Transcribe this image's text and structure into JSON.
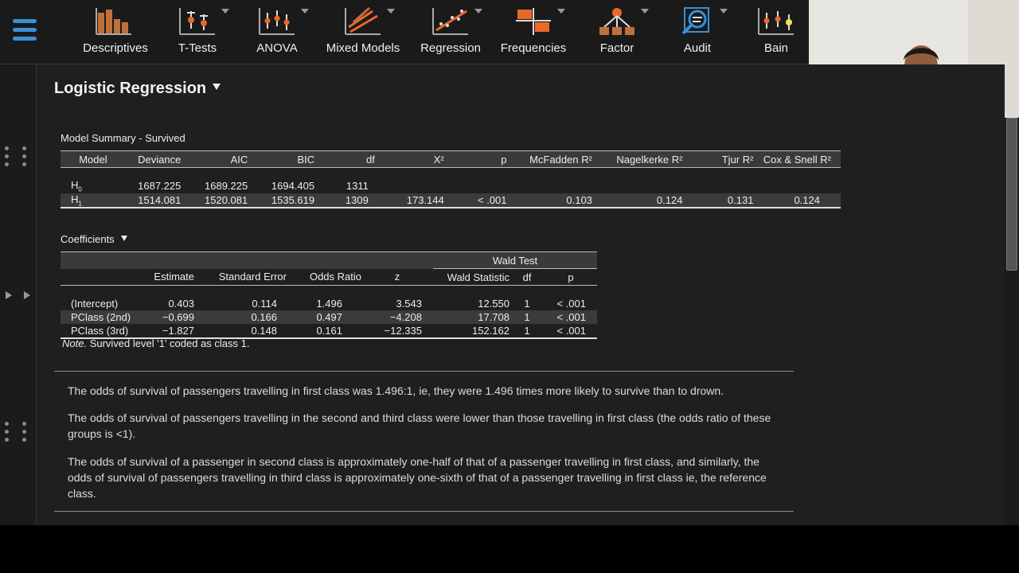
{
  "toolbar": {
    "modules": [
      {
        "label": "Descriptives",
        "icon": "descriptives-icon"
      },
      {
        "label": "T-Tests",
        "icon": "t-tests-icon"
      },
      {
        "label": "ANOVA",
        "icon": "anova-icon"
      },
      {
        "label": "Mixed Models",
        "icon": "mixed-models-icon"
      },
      {
        "label": "Regression",
        "icon": "regression-icon"
      },
      {
        "label": "Frequencies",
        "icon": "frequencies-icon"
      },
      {
        "label": "Factor",
        "icon": "factor-icon"
      },
      {
        "label": "Audit",
        "icon": "audit-icon"
      },
      {
        "label": "Bain",
        "icon": "bain-icon"
      }
    ],
    "colors": {
      "accent": "#3a8fd8",
      "orange": "#e8692a",
      "bar": "#c0703a"
    }
  },
  "analysis": {
    "title": "Logistic Regression"
  },
  "model_summary": {
    "title": "Model Summary - Survived",
    "columns": [
      "Model",
      "Deviance",
      "AIC",
      "BIC",
      "df",
      "X²",
      "p",
      "McFadden R²",
      "Nagelkerke R²",
      "Tjur R²",
      "Cox & Snell R²"
    ],
    "rows": [
      {
        "model": "H",
        "sub": "0",
        "deviance": "1687.225",
        "aic": "1689.225",
        "bic": "1694.405",
        "df": "1311",
        "x2": "",
        "p": "",
        "mcfadden": "",
        "nagelkerke": "",
        "tjur": "",
        "coxsnell": ""
      },
      {
        "model": "H",
        "sub": "1",
        "deviance": "1514.081",
        "aic": "1520.081",
        "bic": "1535.619",
        "df": "1309",
        "x2": "173.144",
        "p": "< .001",
        "mcfadden": "0.103",
        "nagelkerke": "0.124",
        "tjur": "0.131",
        "coxsnell": "0.124"
      }
    ]
  },
  "coefficients": {
    "title": "Coefficients",
    "group_header": "Wald Test",
    "columns": [
      "",
      "Estimate",
      "Standard Error",
      "Odds Ratio",
      "z",
      "Wald Statistic",
      "df",
      "p"
    ],
    "rows": [
      {
        "term": "(Intercept)",
        "estimate": "0.403",
        "se": "0.114",
        "or": "1.496",
        "z": "3.543",
        "wald": "12.550",
        "df": "1",
        "p": "< .001"
      },
      {
        "term": "PClass (2nd)",
        "estimate": "−0.699",
        "se": "0.166",
        "or": "0.497",
        "z": "−4.208",
        "wald": "17.708",
        "df": "1",
        "p": "< .001"
      },
      {
        "term": "PClass (3rd)",
        "estimate": "−1.827",
        "se": "0.148",
        "or": "0.161",
        "z": "−12.335",
        "wald": "152.162",
        "df": "1",
        "p": "< .001"
      }
    ],
    "note_label": "Note.",
    "note_text": " Survived level '1' coded as class 1."
  },
  "notes": [
    "The odds of survival of passengers travelling in first class was 1.496:1, ie, they were 1.496 times more likely to survive than to drown.",
    "The odds of survival of passengers travelling in the second and third class were lower than those travelling in first class (the odds ratio of these groups is <1).",
    "The odds of survival of a passenger in second class is approximately one-half of that of a passenger travelling in first class, and similarly, the odds of survival of passengers travelling in third class is approximately one-sixth of that of a passenger travelling in first class ie, the reference class."
  ]
}
